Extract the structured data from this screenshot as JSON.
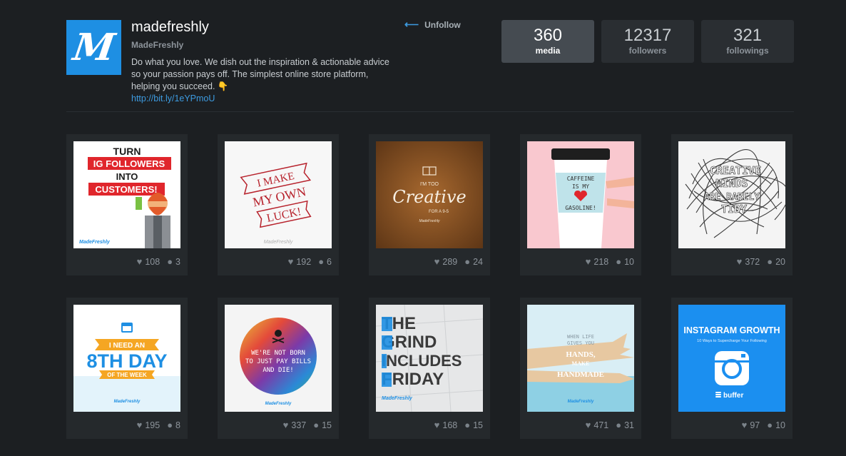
{
  "profile": {
    "logo_letter": "M",
    "username": "madefreshly",
    "fullname": "MadeFreshly",
    "bio": "Do what you love. We dish out the inspiration & actionable advice so your passion pays off. The simplest online store platform, helping you succeed. 👇",
    "link": "http://bit.ly/1eYPmoU"
  },
  "actions": {
    "unfollow_label": "Unfollow"
  },
  "stats": [
    {
      "value": "360",
      "label": "media",
      "active": true
    },
    {
      "value": "12317",
      "label": "followers"
    },
    {
      "value": "321",
      "label": "followings"
    }
  ],
  "posts": [
    {
      "likes": "108",
      "comments": "3",
      "texts": [
        "TURN",
        "IG FOLLOWERS",
        "INTO",
        "CUSTOMERS!",
        "MadeFreshly"
      ]
    },
    {
      "likes": "192",
      "comments": "6",
      "texts": [
        "I MAKE",
        "MY OWN",
        "LUCK!",
        "MadeFreshly"
      ]
    },
    {
      "likes": "289",
      "comments": "24",
      "texts": [
        "I'M TOO",
        "Creative",
        "FOR A 9-5",
        "MadeFreshly"
      ]
    },
    {
      "likes": "218",
      "comments": "10",
      "texts": [
        "CAFFEINE",
        "IS MY",
        "GASOLINE!"
      ]
    },
    {
      "likes": "372",
      "comments": "20",
      "texts": [
        "CREATIVE",
        "MINDS",
        "ARE RARELY",
        "TIDY"
      ]
    },
    {
      "likes": "195",
      "comments": "8",
      "texts": [
        "I NEED AN",
        "8TH DAY",
        "OF THE WEEK",
        "MadeFreshly"
      ]
    },
    {
      "likes": "337",
      "comments": "15",
      "texts": [
        "WE'RE NOT BORN",
        "TO JUST PAY BILLS",
        "AND DIE!",
        "MadeFreshly"
      ]
    },
    {
      "likes": "168",
      "comments": "15",
      "texts": [
        "THE",
        "GRIND",
        "INCLUDES",
        "FRIDAY",
        "MadeFreshly"
      ]
    },
    {
      "likes": "471",
      "comments": "31",
      "texts": [
        "WHEN LIFE",
        "GIVES YOU",
        "HANDS,",
        "MAKE",
        "HANDMADE",
        "MadeFreshly"
      ]
    },
    {
      "likes": "97",
      "comments": "10",
      "texts": [
        "INSTAGRAM GROWTH",
        "10 Ways to Supercharge Your Following",
        "buffer"
      ]
    }
  ],
  "icons": {
    "like": "heart-icon",
    "comment": "comment-bubble-icon",
    "back": "arrow-left-icon"
  },
  "colors": {
    "background": "#1c1f22",
    "card": "#25292c",
    "accent": "#1e8fe3",
    "link": "#3d9be0"
  }
}
